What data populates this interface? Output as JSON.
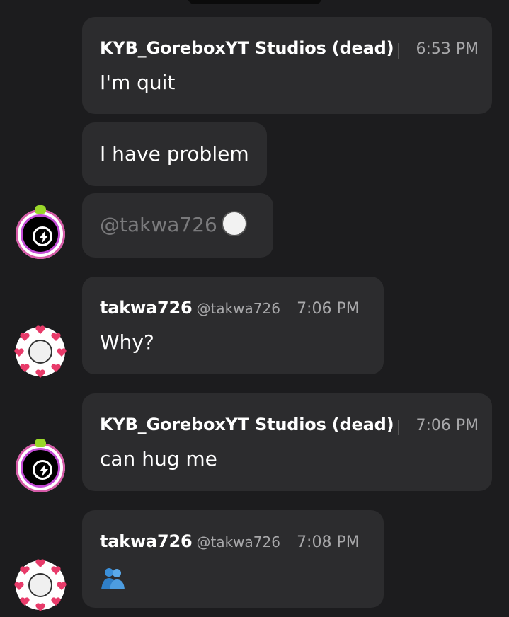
{
  "messages": [
    {
      "author": "KYB_GoreboxYT Studios (dead)",
      "time": "6:53 PM",
      "text": "I'm quit"
    },
    {
      "text": "I have problem"
    },
    {
      "mention": "@takwa726"
    },
    {
      "author": "takwa726",
      "handle": "@takwa726",
      "time": "7:06 PM",
      "text": "Why?"
    },
    {
      "author": "KYB_GoreboxYT Studios (dead)",
      "time": "7:06 PM",
      "text": "can hug me"
    },
    {
      "author": "takwa726",
      "handle": "@takwa726",
      "time": "7:08 PM",
      "emoji": "people-hugging-emoji"
    }
  ],
  "colors": {
    "background": "#1c1c1e",
    "bubble": "#2c2c2e",
    "secondary_text": "#a8a8aa",
    "mention": "#7a7a7c"
  }
}
